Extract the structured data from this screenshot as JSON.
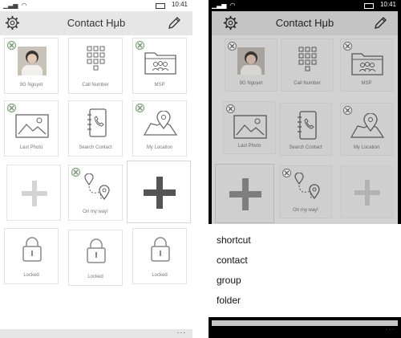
{
  "status_bar": {
    "time_left": "10:41",
    "time_right": "10:41"
  },
  "header": {
    "title": "Contact Hμb",
    "settings_icon": "gear-icon",
    "edit_icon": "pencil-icon"
  },
  "tiles": [
    {
      "label": "9G Nguyet",
      "icon": "photo-portrait-icon"
    },
    {
      "label": "Call Number",
      "icon": "dialpad-icon"
    },
    {
      "label": "MSP",
      "icon": "folder-group-icon"
    },
    {
      "label": "Last Photo",
      "icon": "landscape-photo-icon"
    },
    {
      "label": "Search Contact",
      "icon": "contact-book-icon"
    },
    {
      "label": "My Location",
      "icon": "map-pin-icon"
    },
    {
      "label": "",
      "icon": "plus-icon"
    },
    {
      "label": "On my way!",
      "icon": "route-icon"
    },
    {
      "label": "",
      "icon": "plus-icon"
    },
    {
      "label": "Locked",
      "icon": "lock-icon"
    },
    {
      "label": "Locked",
      "icon": "lock-icon"
    },
    {
      "label": "Locked",
      "icon": "lock-icon"
    }
  ],
  "add_menu": {
    "items": [
      "shortcut",
      "contact",
      "group",
      "folder"
    ]
  },
  "app_bar": {
    "more_label": "..."
  },
  "colors": {
    "header_bg": "#e6e6e6",
    "tile_border": "#e2e2e2",
    "badge_green": "#7a9a7a",
    "dim_overlay": "#d2d2d2"
  }
}
